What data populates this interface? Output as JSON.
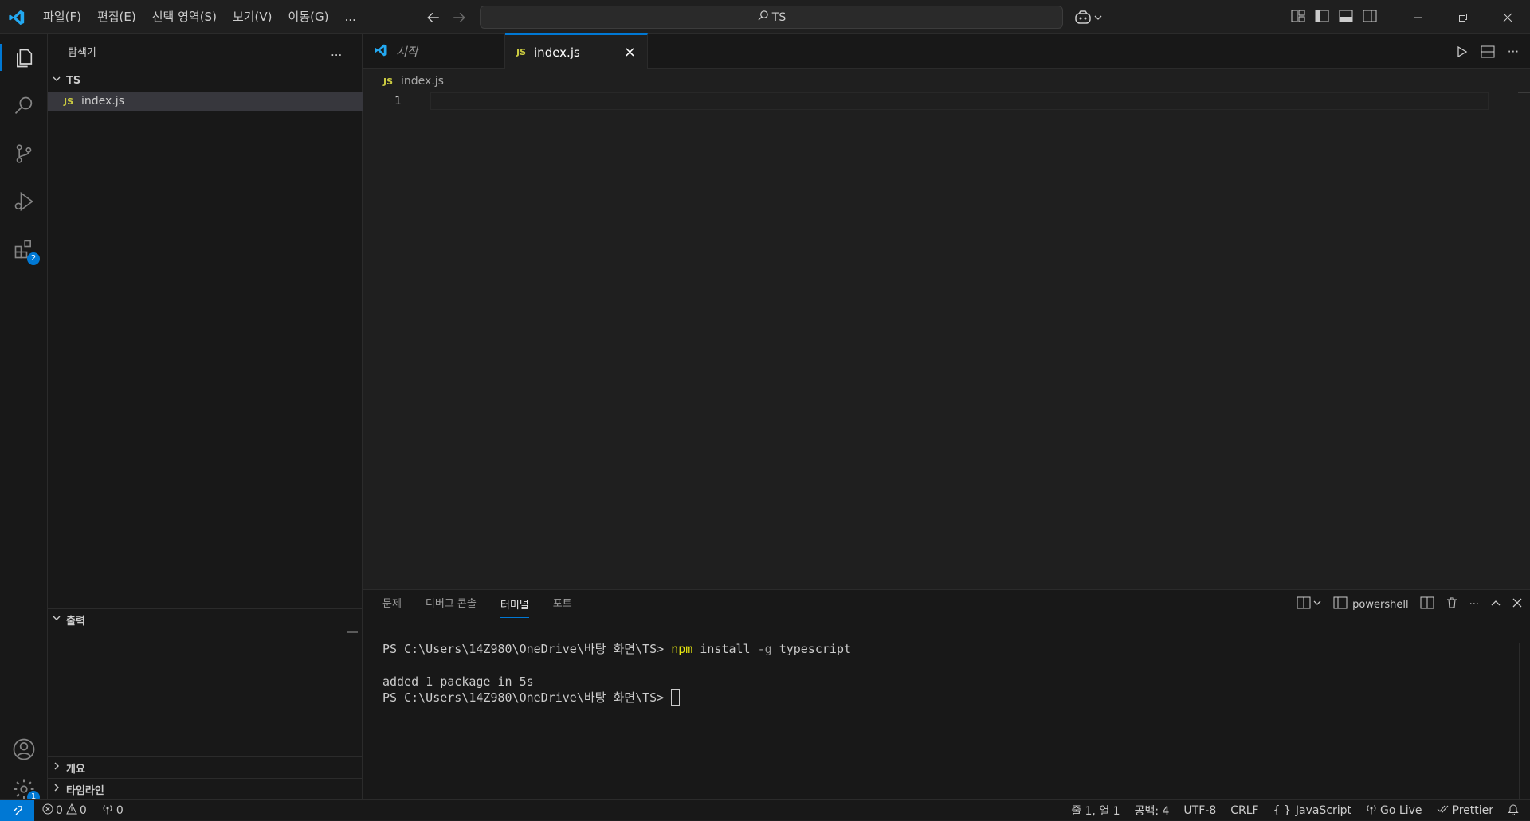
{
  "menu": [
    "파일(F)",
    "편집(E)",
    "선택 영역(S)",
    "보기(V)",
    "이동(G)",
    "..."
  ],
  "search": {
    "text": "TS"
  },
  "activity": {
    "extensions_badge": "2",
    "settings_badge": "1"
  },
  "sidebar": {
    "title": "탐색기",
    "more": "...",
    "folder": "TS",
    "files": [
      {
        "badge": "JS",
        "name": "index.js"
      }
    ],
    "sections": {
      "output": "출력",
      "outline": "개요",
      "timeline": "타임라인"
    }
  },
  "editor": {
    "tabs": [
      {
        "label": "시작"
      },
      {
        "badge": "JS",
        "label": "index.js",
        "close": "×"
      }
    ],
    "breadcrumb": {
      "badge": "JS",
      "file": "index.js"
    },
    "line_number": "1"
  },
  "panel": {
    "tabs": [
      "문제",
      "디버그 콘솔",
      "터미널",
      "포트"
    ],
    "active_tab": "터미널",
    "shell": "powershell",
    "terminal": {
      "prompt": "PS C:\\Users\\14Z980\\OneDrive\\바탕 화면\\TS>",
      "cmd": "npm",
      "args1": "install",
      "flag": "-g",
      "args2": "typescript",
      "output": "added 1 package in 5s",
      "prompt2": "PS C:\\Users\\14Z980\\OneDrive\\바탕 화면\\TS>"
    }
  },
  "status": {
    "errors": "0",
    "warnings": "0",
    "ports": "0",
    "position": "줄 1, 열 1",
    "spaces": "공백: 4",
    "encoding": "UTF-8",
    "eol": "CRLF",
    "language": "JavaScript",
    "language_prefix": "{ }",
    "golive": "Go Live",
    "prettier": "Prettier"
  },
  "colors": {
    "accent": "#0078d4",
    "js": "#cbcb41",
    "vscode_blue": "#23a9f2"
  }
}
